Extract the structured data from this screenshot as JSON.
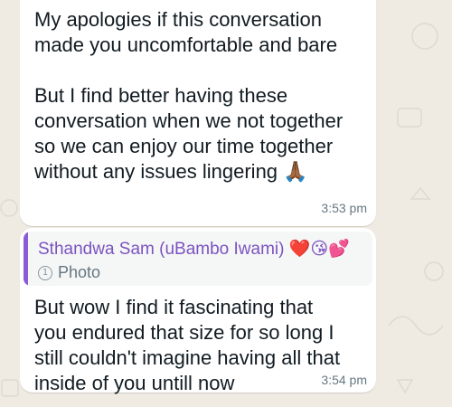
{
  "messages": [
    {
      "text": "My apologies if this conversation\nmade you uncomfortable and bare\n\nBut I find better having these\nconversation when we not together\nso we can enjoy our time together\nwithout any issues lingering",
      "emoji": "🙏🏾",
      "time": "3:53 pm"
    },
    {
      "quote_author": "Sthandwa Sam (uBambo Iwami)",
      "quote_emoji": "❤️😘💕",
      "quote_type": "Photo",
      "text": "But wow I find it fascinating that\nyou endured that size for so long I\nstill couldn't imagine having all that\ninside of you untill now",
      "time": "3:54 pm"
    }
  ],
  "colors": {
    "chat_background": "#efeae2",
    "bubble": "#ffffff",
    "quote_bar": "#8c5bd6",
    "quote_author": "#7b53c1",
    "timestamp": "#667781"
  },
  "icons": {
    "quoted_media": "view-once-photo-icon"
  }
}
